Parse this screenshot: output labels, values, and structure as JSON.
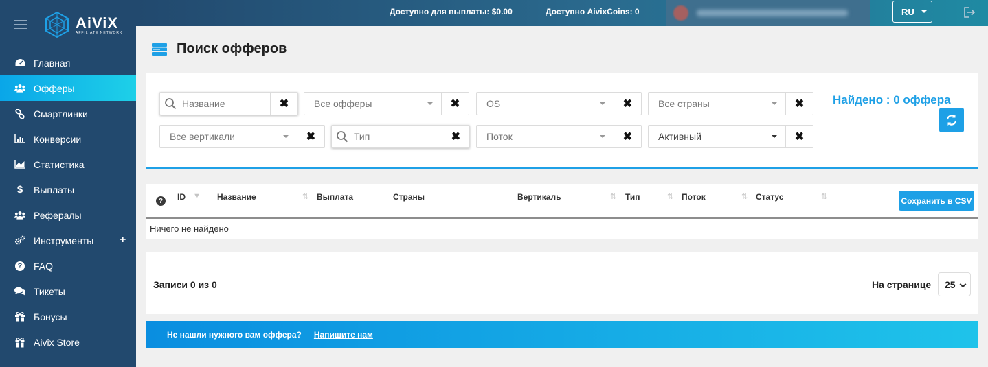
{
  "brand": {
    "name": "AiViX",
    "tagline": "AFFILIATE NETWORK"
  },
  "topbar": {
    "payout": "Доступно для выплаты: $0.00",
    "coins": "Доступно AivixCoins: 0",
    "lang": "RU"
  },
  "sidebar": {
    "items": [
      {
        "label": "Главная",
        "icon": "dashboard-icon"
      },
      {
        "label": "Офферы",
        "icon": "users-icon",
        "active": true
      },
      {
        "label": "Смартлинки",
        "icon": "link-icon"
      },
      {
        "label": "Конверсии",
        "icon": "bar-chart-icon"
      },
      {
        "label": "Статистика",
        "icon": "area-chart-icon"
      },
      {
        "label": "Выплаты",
        "icon": "dollar-icon"
      },
      {
        "label": "Рефералы",
        "icon": "users-icon"
      },
      {
        "label": "Инструменты",
        "icon": "cogs-icon",
        "expand": "+"
      },
      {
        "label": "FAQ",
        "icon": "question-icon"
      },
      {
        "label": "Тикеты",
        "icon": "comments-icon"
      },
      {
        "label": "Бонусы",
        "icon": "gift-icon"
      },
      {
        "label": "Aivix Store",
        "icon": "gift-icon"
      }
    ]
  },
  "page": {
    "title": "Поиск офферов"
  },
  "filters": {
    "name_placeholder": "Название",
    "all_offers": "Все офферы",
    "os": "OS",
    "all_countries": "Все страны",
    "all_verticals": "Все вертикали",
    "type_placeholder": "Тип",
    "flow": "Поток",
    "status": "Активный",
    "clear_glyph": "✖",
    "found": "Найдено  : 0 оффера"
  },
  "table": {
    "columns": [
      "ID",
      "Название",
      "Выплата",
      "Страны",
      "Вертикаль",
      "Тип",
      "Поток",
      "Статус"
    ],
    "help": "?",
    "csv_button": "Сохранить в CSV",
    "empty": "Ничего не найдено"
  },
  "pagination": {
    "records": "Записи 0 из 0",
    "per_page_label": "На странице",
    "per_page": "25"
  },
  "banner": {
    "text": "Не нашли нужного вам оффера?",
    "link": "Напишите нам"
  },
  "colors": {
    "sidebar": "#22496e",
    "accent": "#1ea0e6"
  }
}
